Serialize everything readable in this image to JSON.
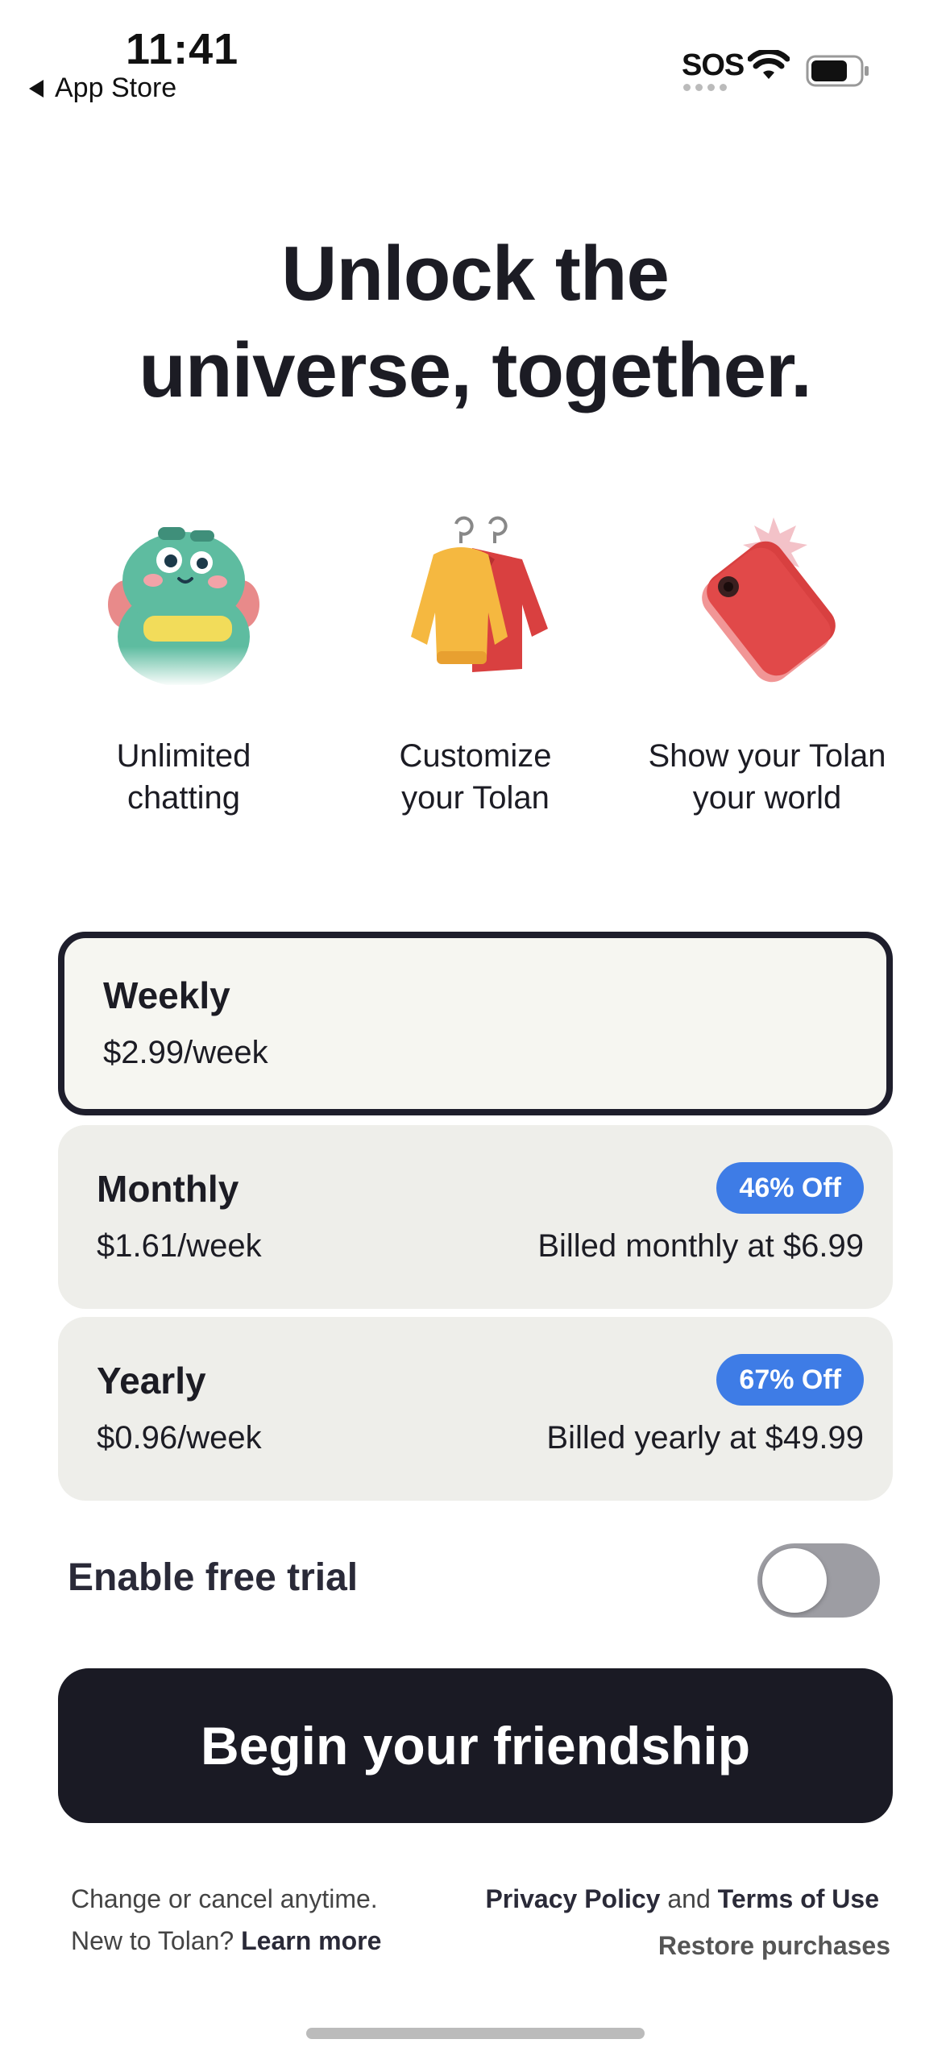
{
  "status_bar": {
    "time": "11:41",
    "back_label": "App Store",
    "sos": "SOS"
  },
  "headline": {
    "line1": "Unlock the",
    "line2": "universe, together."
  },
  "features": [
    {
      "icon": "frog-character-icon",
      "line1": "Unlimited",
      "line2": "chatting"
    },
    {
      "icon": "clothing-hanger-icon",
      "line1": "Customize",
      "line2": "your Tolan"
    },
    {
      "icon": "phone-camera-icon",
      "line1": "Show your Tolan",
      "line2": "your world"
    }
  ],
  "plans": [
    {
      "name": "Weekly",
      "price": "$2.99/week",
      "selected": true
    },
    {
      "name": "Monthly",
      "price": "$1.61/week",
      "badge": "46% Off",
      "billed": "Billed monthly at $6.99"
    },
    {
      "name": "Yearly",
      "price": "$0.96/week",
      "badge": "67% Off",
      "billed": "Billed yearly at $49.99"
    }
  ],
  "trial": {
    "label": "Enable free trial",
    "enabled": false
  },
  "cta": {
    "label": "Begin your friendship"
  },
  "footer": {
    "change_text": "Change or cancel anytime.",
    "new_text": "New to Tolan?",
    "learn_more": "Learn more",
    "privacy": "Privacy Policy",
    "and": "and",
    "terms": "Terms of Use",
    "restore": "Restore purchases"
  },
  "colors": {
    "accent_badge": "#3e7ce6",
    "cta_bg": "#1a1a24",
    "plan_bg": "#eeeeea"
  }
}
